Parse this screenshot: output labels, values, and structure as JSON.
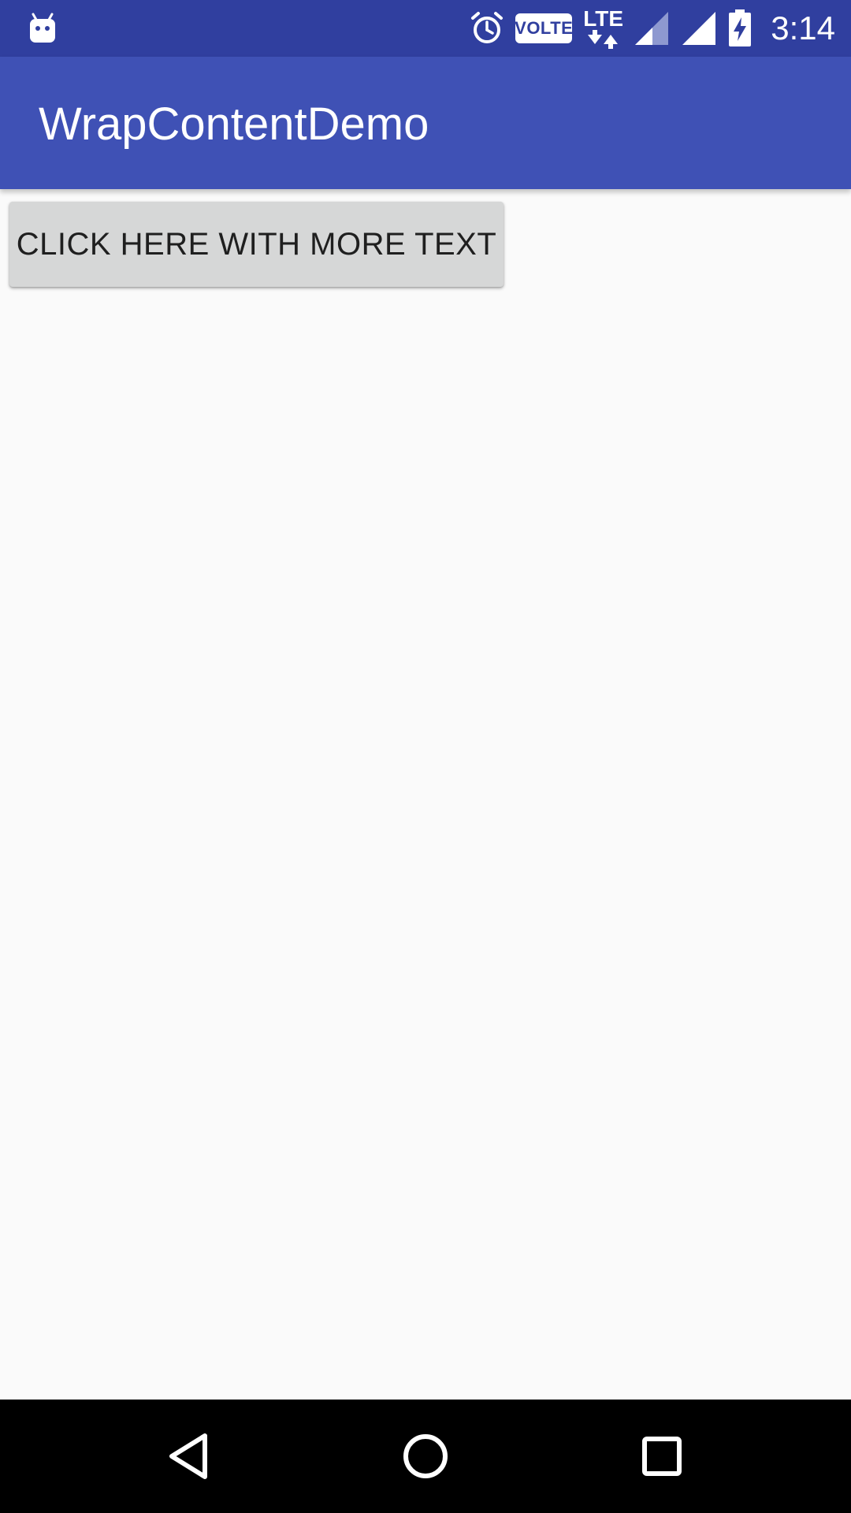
{
  "status_bar": {
    "time": "3:14",
    "volte_label": "VOLTE",
    "network_label": "LTE",
    "icons": [
      "android-notification-icon",
      "alarm-icon",
      "volte-icon",
      "lte-data-icon",
      "signal-icon",
      "signal-full-icon",
      "battery-charging-icon"
    ],
    "background_color": "#303f9f"
  },
  "app_bar": {
    "title": "WrapContentDemo",
    "background_color": "#3f51b5"
  },
  "content": {
    "button_label": "CLICK HERE WITH MORE TEXT",
    "button_color": "#d6d7d7"
  },
  "nav_bar": {
    "icons": [
      "back-icon",
      "home-icon",
      "recents-icon"
    ]
  }
}
